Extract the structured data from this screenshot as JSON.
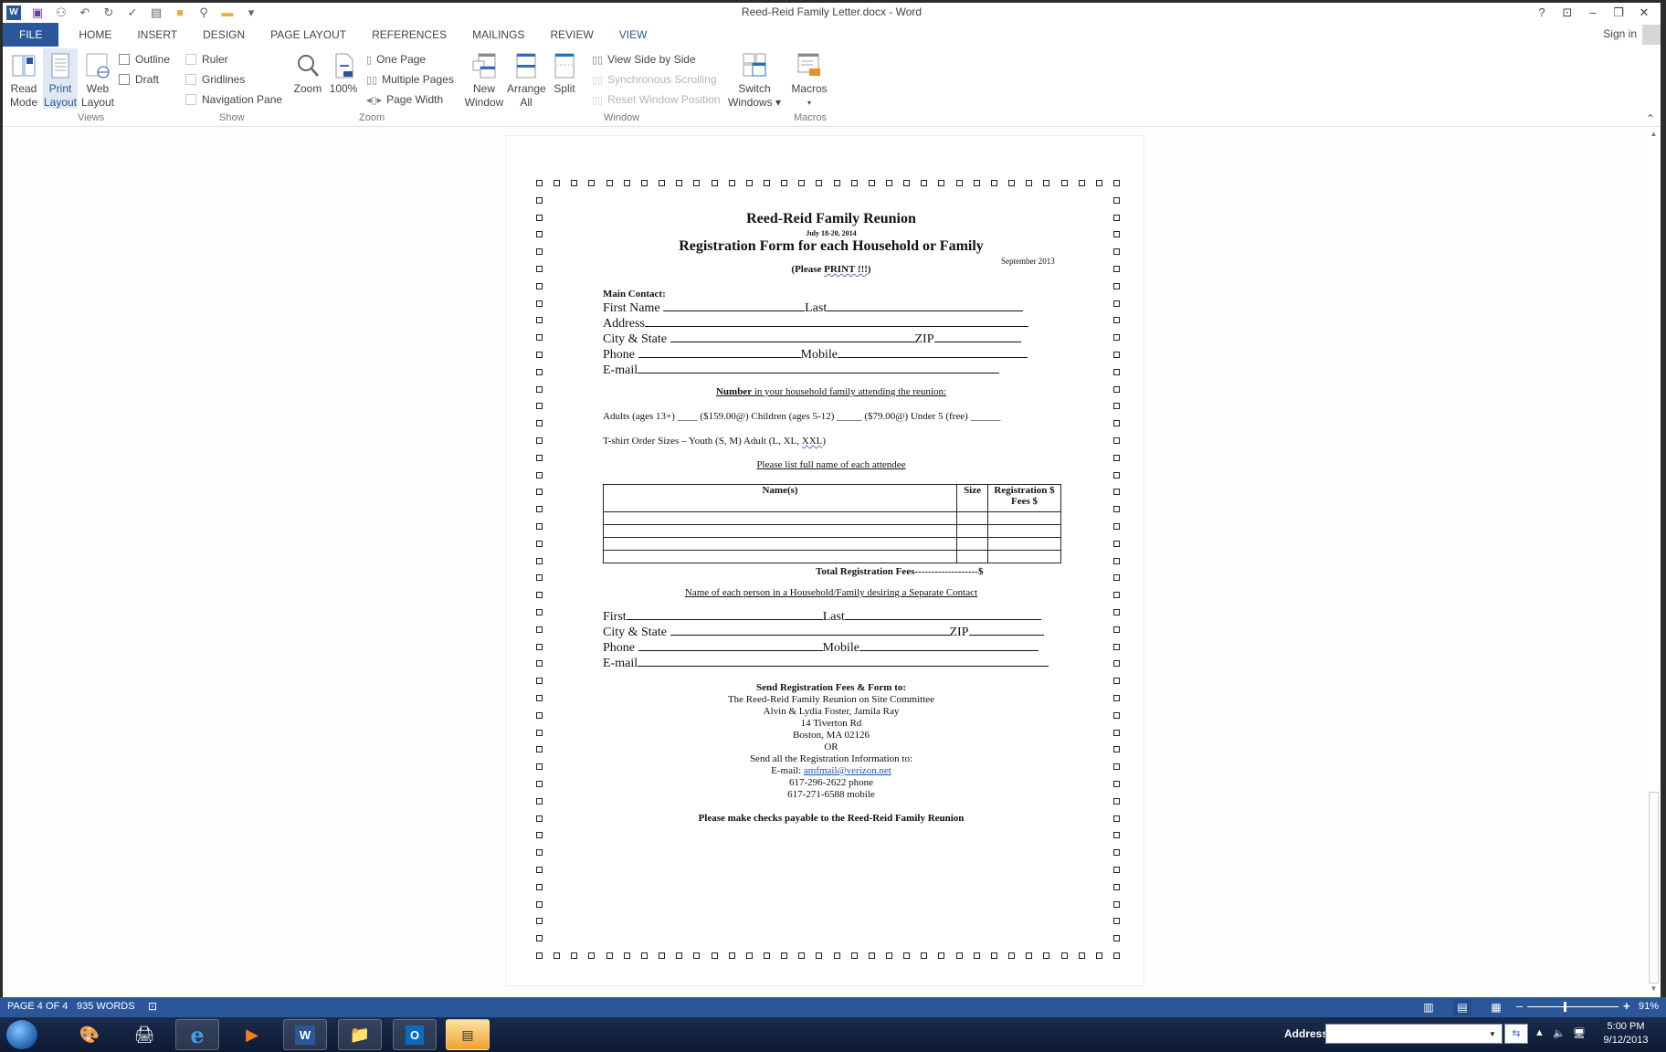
{
  "window": {
    "title": "Reed-Reid Family Letter.docx - Word",
    "controls": {
      "help": "?",
      "ribbon_display": "⊡",
      "minimize": "–",
      "restore": "❐",
      "close": "✕"
    },
    "sign_in": "Sign in"
  },
  "quick_access": [
    "word-icon",
    "save-icon",
    "touch-mode-icon",
    "undo-icon",
    "redo-icon",
    "spelling-icon",
    "view-icon",
    "new-icon",
    "print-preview-icon",
    "open-folder-icon",
    "customize-icon"
  ],
  "tabs": [
    {
      "label": "FILE"
    },
    {
      "label": "HOME"
    },
    {
      "label": "INSERT"
    },
    {
      "label": "DESIGN"
    },
    {
      "label": "PAGE LAYOUT"
    },
    {
      "label": "REFERENCES"
    },
    {
      "label": "MAILINGS"
    },
    {
      "label": "REVIEW"
    },
    {
      "label": "VIEW"
    }
  ],
  "active_tab": "VIEW",
  "ribbon": {
    "views": {
      "label": "Views",
      "read_mode": [
        "Read",
        "Mode"
      ],
      "print_layout": [
        "Print",
        "Layout"
      ],
      "web_layout": [
        "Web",
        "Layout"
      ],
      "outline": "Outline",
      "draft": "Draft"
    },
    "show": {
      "label": "Show",
      "ruler": "Ruler",
      "gridlines": "Gridlines",
      "navigation_pane": "Navigation Pane"
    },
    "zoom": {
      "label": "Zoom",
      "zoom": "Zoom",
      "hundred": "100%",
      "one_page": "One Page",
      "multiple_pages": "Multiple Pages",
      "page_width": "Page Width"
    },
    "window": {
      "label": "Window",
      "new_window": [
        "New",
        "Window"
      ],
      "arrange_all": [
        "Arrange",
        "All"
      ],
      "split": "Split",
      "view_side_by_side": "View Side by Side",
      "synchronous_scrolling": "Synchronous Scrolling",
      "reset_window_position": "Reset Window Position",
      "switch_windows": [
        "Switch",
        "Windows ▾"
      ]
    },
    "macros": {
      "label": "Macros",
      "macros": "Macros",
      "arrow": "▾"
    }
  },
  "document": {
    "title": "Reed-Reid Family Reunion",
    "dates": "July 18-20, 2014",
    "subtitle": "Registration Form for each Household or Family",
    "revision_date": "September 2013",
    "please_print_prefix": "(Please ",
    "please_print_word": "PRINT !!!",
    "please_print_suffix": ")",
    "main_contact_label": "Main Contact:",
    "main_fields": {
      "first_name": "First Name",
      "last": "Last",
      "address": "Address",
      "city_state": "City & State",
      "zip": "ZIP",
      "phone": "Phone",
      "mobile": "Mobile",
      "email": "E-mail"
    },
    "number_heading_bold": "Number",
    "number_heading_rest": " in your household family attending the reunion:",
    "adults_line": "Adults (ages 13+) ____ ($159.00@)     Children (ages 5-12) _____ ($79.00@) Under 5 (free) ______",
    "tshirt_prefix": "T-shirt Order Sizes – Youth (S, M)   Adult (L, XL, ",
    "tshirt_xxl": "XXL",
    "tshirt_suffix": ")",
    "attendee_heading": "Please list full name of each attendee",
    "table": {
      "headers": [
        "Name(s)",
        "Size",
        "Registration $ Fees $"
      ],
      "rows": [
        [
          "",
          "",
          ""
        ],
        [
          "",
          "",
          ""
        ],
        [
          "",
          "",
          ""
        ],
        [
          "",
          "",
          ""
        ]
      ]
    },
    "total_line": "Total Registration Fees-------------------$",
    "separate_contact_heading": "Name of each person in a Household/Family desiring a Separate Contact",
    "separate_fields": {
      "first": "First",
      "last": "Last",
      "city_state": "City & State",
      "zip": "ZIP",
      "phone": "Phone",
      "mobile": "Mobile",
      "email": "E-mail"
    },
    "send_heading": "Send Registration Fees & Form to:",
    "address_lines": [
      "The Reed-Reid Family Reunion on Site Committee",
      "Alvin & Lydia Foster, Jamila Ray",
      "14 Tiverton Rd",
      "Boston, MA  02126",
      "OR",
      "Send all the Registration Information to:"
    ],
    "email_prefix": "E-mail: ",
    "email_address": "amfmail@verizon.net",
    "phone_line": "617-296-2622 phone",
    "mobile_line": "617-271-6588 mobile",
    "checks_line": "Please make checks payable to the Reed-Reid Family Reunion"
  },
  "status_bar": {
    "page": "PAGE 4 OF 4",
    "words": "935 WORDS",
    "proofing_icon": "proofing-icon",
    "zoom_minus": "–",
    "zoom_plus": "+",
    "zoom_level": "91%"
  },
  "taskbar": {
    "apps": [
      "paint",
      "scanner",
      "internet-explorer",
      "media-player",
      "word",
      "file-explorer",
      "outlook",
      "document-viewer"
    ],
    "address_label": "Address",
    "address_value": "",
    "time": "5:00 PM",
    "date": "9/12/2013"
  }
}
